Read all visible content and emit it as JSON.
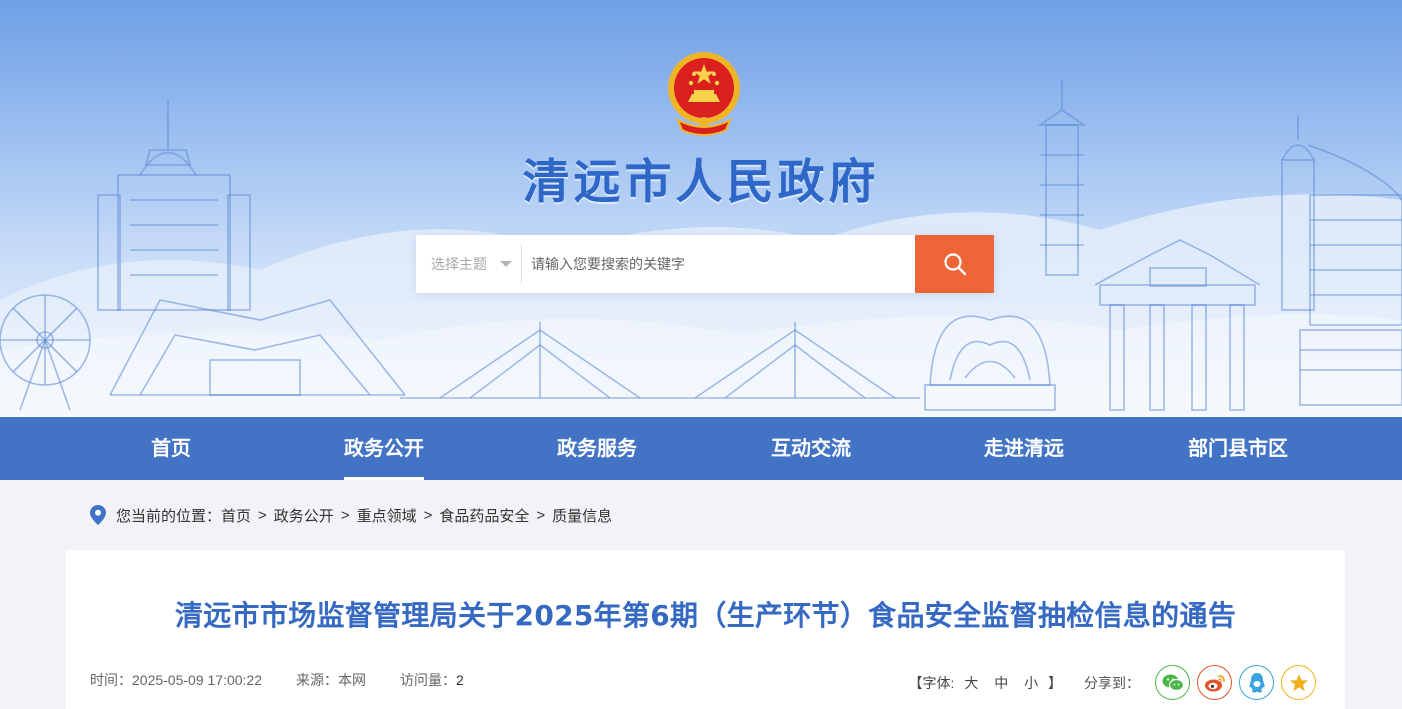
{
  "site": {
    "title": "清远市人民政府",
    "emblem_text": ""
  },
  "search": {
    "topic_select_label": "选择主题",
    "input_placeholder": "请输入您要搜索的关键字",
    "search_button_icon": "search-icon"
  },
  "nav": {
    "items": [
      {
        "label": "首页",
        "active": false
      },
      {
        "label": "政务公开",
        "active": true
      },
      {
        "label": "政务服务",
        "active": false
      },
      {
        "label": "互动交流",
        "active": false
      },
      {
        "label": "走进清远",
        "active": false
      },
      {
        "label": "部门县市区",
        "active": false
      }
    ]
  },
  "breadcrumb": {
    "prefix": "您当前的位置：",
    "items": [
      "首页",
      "政务公开",
      "重点领域",
      "食品药品安全",
      "质量信息"
    ],
    "separator": ">"
  },
  "article": {
    "title": "清远市市场监督管理局关于2025年第6期（生产环节）食品安全监督抽检信息的通告",
    "time_label": "时间：",
    "time_value": "2025-05-09 17:00:22",
    "source_label": "来源：",
    "source_value": "本网",
    "hits_label": "访问量：",
    "hits_value": "2"
  },
  "tools": {
    "font_open": "【字体:",
    "font_large": "大",
    "font_medium": "中",
    "font_small": "小",
    "font_close": "】",
    "share_label": "分享到：",
    "share_buttons": [
      "wechat-icon",
      "weibo-icon",
      "qq-icon",
      "qzone-icon"
    ]
  },
  "colors": {
    "nav_bg": "#4273c5",
    "title_blue": "#3669c2",
    "search_button": "#ee6637",
    "wechat": "#4cb548",
    "weibo": "#e3532b",
    "qq": "#3aa3e0",
    "qzone": "#f2b01e",
    "page_bg": "#f1f3f6"
  }
}
